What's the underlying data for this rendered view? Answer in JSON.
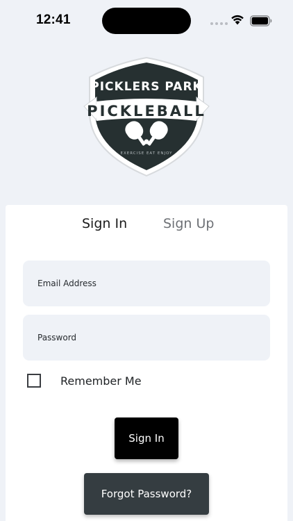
{
  "status_bar": {
    "time": "12:41"
  },
  "logo": {
    "top_text": "PICKLERS PARK",
    "banner_text": "PICKLEBALL",
    "tagline": "EXERCISE  EAT  ENJOY"
  },
  "tabs": [
    {
      "label": "Sign In",
      "active": true
    },
    {
      "label": "Sign Up",
      "active": false
    }
  ],
  "form": {
    "email_placeholder": "Email Address",
    "email_value": "",
    "password_placeholder": "Password",
    "password_value": "",
    "remember_label": "Remember Me",
    "remember_checked": false
  },
  "buttons": {
    "signin_label": "Sign In",
    "forgot_label": "Forgot Password?"
  },
  "colors": {
    "background": "#eff2f7",
    "card": "#ffffff",
    "signin_button": "#000000",
    "forgot_button": "#353d41",
    "badge_dark": "#263031"
  },
  "icons": [
    "wifi-icon",
    "battery-icon",
    "signal-dots-icon",
    "crossed-paddles-icon"
  ]
}
